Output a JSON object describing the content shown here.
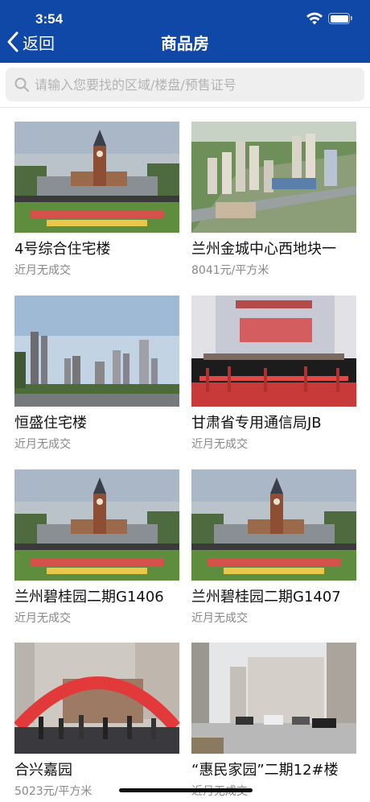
{
  "status_bar": {
    "time": "3:54"
  },
  "nav": {
    "back_label": "返回",
    "title": "商品房"
  },
  "search": {
    "placeholder": "请输入您要找的区域/楼盘/预售证号"
  },
  "colors": {
    "nav_bg": "#1048a8",
    "search_bg": "#efefef",
    "secondary_text": "#888888"
  },
  "listings": [
    {
      "name": "4号综合住宅楼",
      "price": "近月无成交",
      "image": "clock-tower-plaza-photo"
    },
    {
      "name": "兰州金城中心西地块一",
      "price": "8041元/平方米",
      "image": "aerial-rendering-photo"
    },
    {
      "name": "恒盛住宅楼",
      "price": "近月无成交",
      "image": "city-skyline-photo"
    },
    {
      "name": "甘肃省专用通信局JB",
      "price": "近月无成交",
      "image": "groundbreaking-ceremony-photo"
    },
    {
      "name": "兰州碧桂园二期G1406",
      "price": "近月无成交",
      "image": "clock-tower-plaza-photo"
    },
    {
      "name": "兰州碧桂园二期G1407",
      "price": "近月无成交",
      "image": "clock-tower-plaza-photo"
    },
    {
      "name": "合兴嘉园",
      "price": "5023元/平方米",
      "image": "red-arch-opening-photo"
    },
    {
      "name": "“惠民家园”二期12#楼",
      "price": "近月无成交",
      "image": "residential-street-photo"
    }
  ]
}
